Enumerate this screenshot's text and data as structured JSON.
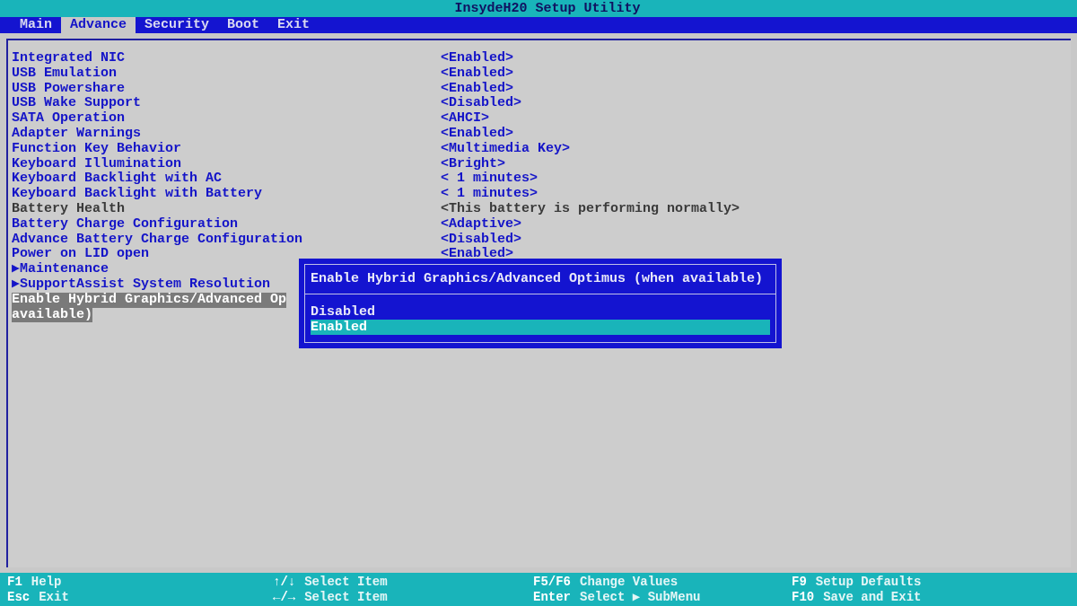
{
  "window": {
    "title": "InsydeH20 Setup Utility"
  },
  "tabs": [
    {
      "label": "Main",
      "selected": false
    },
    {
      "label": "Advance",
      "selected": true
    },
    {
      "label": "Security",
      "selected": false
    },
    {
      "label": "Boot",
      "selected": false
    },
    {
      "label": "Exit",
      "selected": false
    }
  ],
  "items": [
    {
      "kind": "setting",
      "label": "Integrated NIC",
      "value": "<Enabled>",
      "selected": false,
      "disabled": false
    },
    {
      "kind": "setting",
      "label": "USB Emulation",
      "value": "<Enabled>",
      "selected": false,
      "disabled": false
    },
    {
      "kind": "setting",
      "label": "USB Powershare",
      "value": "<Enabled>",
      "selected": false,
      "disabled": false
    },
    {
      "kind": "setting",
      "label": "USB Wake Support",
      "value": "<Disabled>",
      "selected": false,
      "disabled": false
    },
    {
      "kind": "setting",
      "label": "SATA Operation",
      "value": "<AHCI>",
      "selected": false,
      "disabled": false
    },
    {
      "kind": "setting",
      "label": "Adapter Warnings",
      "value": "<Enabled>",
      "selected": false,
      "disabled": false
    },
    {
      "kind": "setting",
      "label": "Function Key Behavior",
      "value": "<Multimedia Key>",
      "selected": false,
      "disabled": false
    },
    {
      "kind": "setting",
      "label": "Keyboard Illumination",
      "value": "<Bright>",
      "selected": false,
      "disabled": false
    },
    {
      "kind": "setting",
      "label": "Keyboard Backlight with AC",
      "value": "< 1 minutes>",
      "selected": false,
      "disabled": false
    },
    {
      "kind": "setting",
      "label": "Keyboard Backlight with Battery",
      "value": "< 1 minutes>",
      "selected": false,
      "disabled": false
    },
    {
      "kind": "setting",
      "label": "Battery Health",
      "value": "<This battery is performing normally>",
      "selected": false,
      "disabled": true
    },
    {
      "kind": "setting",
      "label": "Battery Charge Configuration",
      "value": "<Adaptive>",
      "selected": false,
      "disabled": false
    },
    {
      "kind": "setting",
      "label": "Advance Battery Charge Configuration",
      "value": "<Disabled>",
      "selected": false,
      "disabled": false
    },
    {
      "kind": "setting",
      "label": "Power on LID open",
      "value": "<Enabled>",
      "selected": false,
      "disabled": false
    },
    {
      "kind": "submenu",
      "marker": "▶",
      "label": "Maintenance",
      "selected": false,
      "disabled": false
    },
    {
      "kind": "submenu",
      "marker": "▶",
      "label": "SupportAssist System Resolution",
      "selected": false,
      "disabled": false
    },
    {
      "kind": "wrapped",
      "label_lines": [
        "Enable Hybrid Graphics/Advanced Op",
        "available)"
      ],
      "selected": true,
      "disabled": false
    }
  ],
  "popup": {
    "title": "Enable Hybrid Graphics/Advanced Optimus (when available)",
    "options": [
      {
        "label": "Disabled",
        "selected": false
      },
      {
        "label": "Enabled",
        "selected": true
      }
    ]
  },
  "footer": [
    [
      {
        "key": "F1",
        "action": "Help"
      },
      {
        "key": "Esc",
        "action": "Exit"
      }
    ],
    [
      {
        "key": "↑/↓",
        "action": "Select Item"
      },
      {
        "key": "←/→",
        "action": "Select Item"
      }
    ],
    [
      {
        "key": "F5/F6",
        "action": "Change Values"
      },
      {
        "key": "Enter",
        "action": "Select ▶ SubMenu"
      }
    ],
    [
      {
        "key": "F9",
        "action": "Setup Defaults"
      },
      {
        "key": "F10",
        "action": "Save and Exit"
      }
    ]
  ]
}
